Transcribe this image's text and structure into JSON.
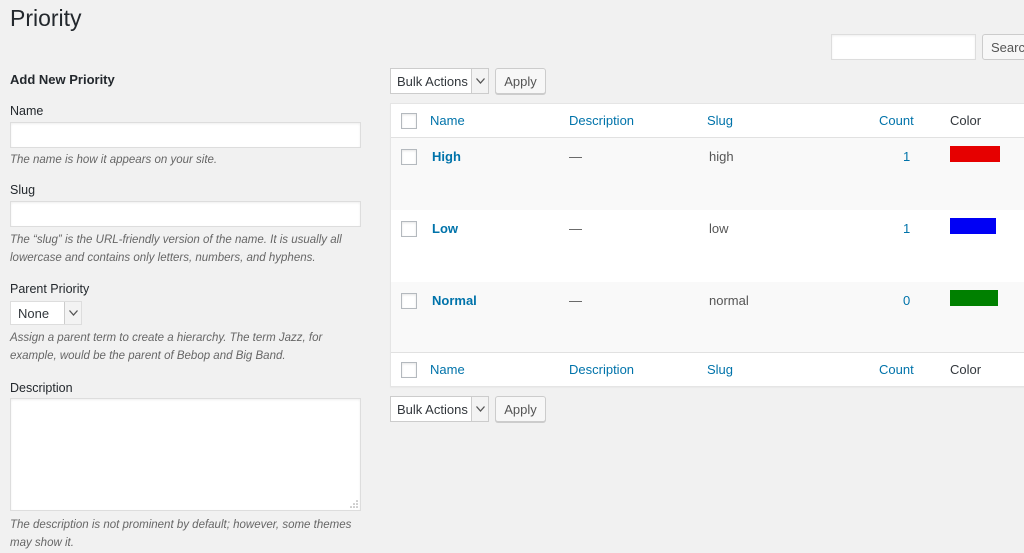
{
  "page": {
    "title": "Priority"
  },
  "search": {
    "placeholder": "",
    "button_label": "Search"
  },
  "form": {
    "heading": "Add New Priority",
    "name_label": "Name",
    "name_value": "",
    "name_help": "The name is how it appears on your site.",
    "slug_label": "Slug",
    "slug_value": "",
    "slug_help": "The “slug” is the URL-friendly version of the name. It is usually all lowercase and contains only letters, numbers, and hyphens.",
    "parent_label": "Parent Priority",
    "parent_value": "None",
    "parent_help": "Assign a parent term to create a hierarchy. The term Jazz, for example, would be the parent of Bebop and Big Band.",
    "description_label": "Description",
    "description_value": "",
    "description_help": "The description is not prominent by default; however, some themes may show it."
  },
  "bulk": {
    "top_label": "Bulk Actions",
    "bottom_label": "Bulk Actions",
    "apply_label": "Apply"
  },
  "table": {
    "columns": {
      "name": "Name",
      "description": "Description",
      "slug": "Slug",
      "count": "Count",
      "color": "Color"
    },
    "rows": [
      {
        "name": "High",
        "description": "—",
        "slug": "high",
        "count": "1",
        "color": "#e60000"
      },
      {
        "name": "Low",
        "description": "—",
        "slug": "low",
        "count": "1",
        "color": "#0000f5"
      },
      {
        "name": "Normal",
        "description": "—",
        "slug": "normal",
        "count": "0",
        "color": "#008000"
      }
    ]
  },
  "icons": {
    "select_arrow": "chevron-down-icon",
    "resize": "resize-grip-icon"
  }
}
